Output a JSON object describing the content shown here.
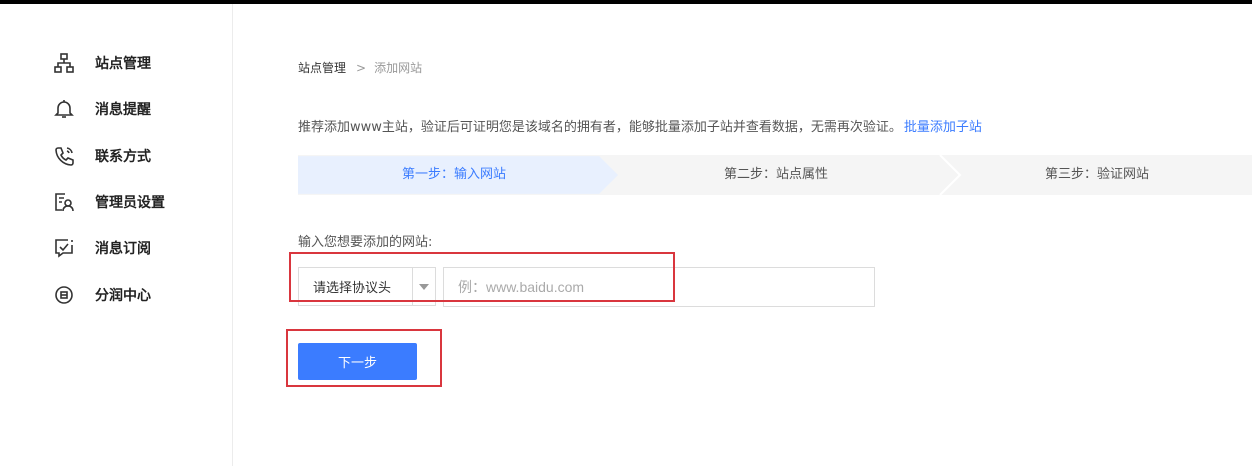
{
  "sidebar": {
    "items": [
      {
        "label": "站点管理",
        "icon": "sitemap-icon"
      },
      {
        "label": "消息提醒",
        "icon": "bell-icon"
      },
      {
        "label": "联系方式",
        "icon": "phone-icon"
      },
      {
        "label": "管理员设置",
        "icon": "admin-user-icon"
      },
      {
        "label": "消息订阅",
        "icon": "subscribe-icon"
      },
      {
        "label": "分润中心",
        "icon": "profit-share-icon"
      }
    ]
  },
  "breadcrumb": {
    "parent": "站点管理",
    "separator": ">",
    "current": "添加网站"
  },
  "notice": {
    "text": "推荐添加www主站，验证后可证明您是该域名的拥有者，能够批量添加子站并查看数据，无需再次验证。",
    "link": "批量添加子站"
  },
  "steps": [
    {
      "label": "第一步：输入网站",
      "active": true
    },
    {
      "label": "第二步：站点属性",
      "active": false
    },
    {
      "label": "第三步：验证网站",
      "active": false
    }
  ],
  "form": {
    "label": "输入您想要添加的网站:",
    "protocol_value": "请选择协议头",
    "url_placeholder": "例：www.baidu.com",
    "url_value": ""
  },
  "next_button": "下一步",
  "colors": {
    "accent": "#3b7cff",
    "step_active_bg": "#e8f0fe",
    "step_bg": "#f5f5f5",
    "highlight": "#d9363e"
  }
}
